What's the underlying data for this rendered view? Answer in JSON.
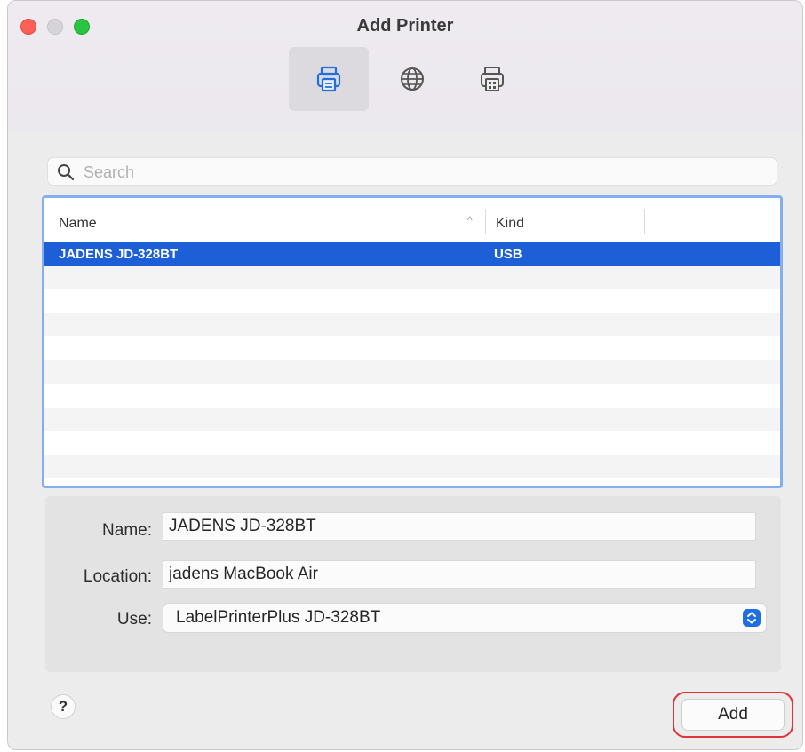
{
  "window": {
    "title": "Add Printer"
  },
  "toolbar": {
    "items": [
      {
        "icon": "default-printer-icon",
        "active": true
      },
      {
        "icon": "ip-globe-icon",
        "active": false
      },
      {
        "icon": "windows-printer-icon",
        "active": false
      }
    ]
  },
  "search": {
    "placeholder": "Search",
    "value": ""
  },
  "printer_list": {
    "columns": [
      "Name",
      "Kind"
    ],
    "sort_indicator": "^",
    "rows": [
      {
        "name": "JADENS JD-328BT",
        "kind": "USB",
        "selected": true
      }
    ],
    "selection_color": "#1d5fd6",
    "focus_ring_color": "#85aef0"
  },
  "details": {
    "name_label": "Name:",
    "name_value": "JADENS JD-328BT",
    "location_label": "Location:",
    "location_value": "jadens MacBook Air",
    "use_label": "Use:",
    "use_value": "LabelPrinterPlus JD-328BT"
  },
  "footer": {
    "help_label": "?",
    "add_label": "Add",
    "highlight_color": "#e0333a"
  }
}
